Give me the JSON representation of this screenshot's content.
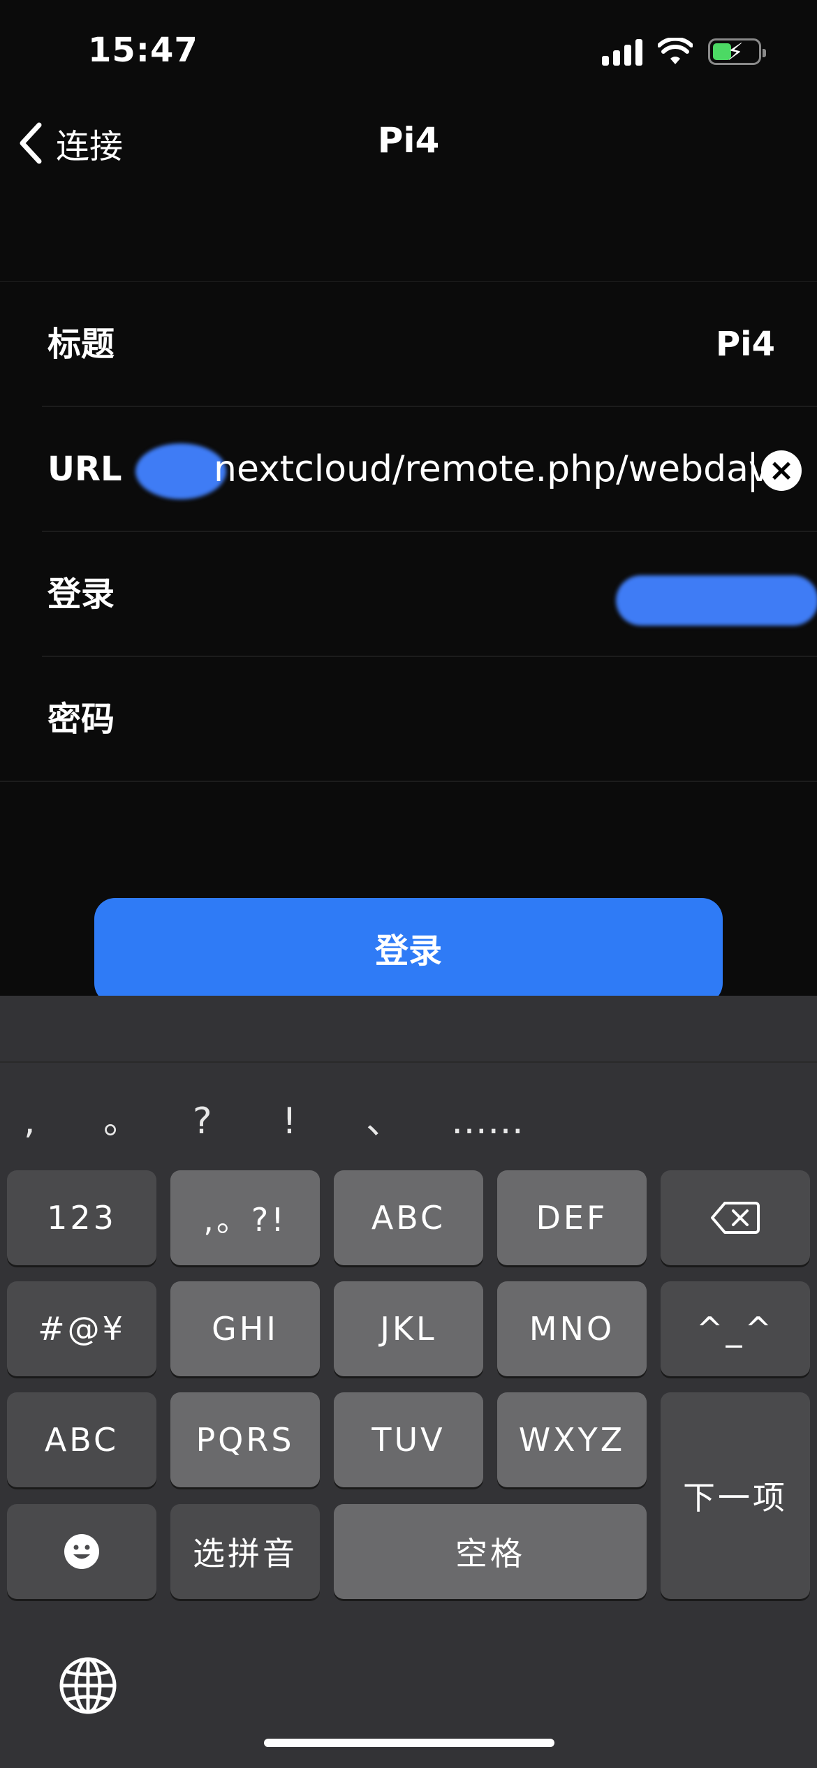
{
  "status_bar": {
    "time": "15:47"
  },
  "nav": {
    "back_label": "连接",
    "title": "Pi4"
  },
  "form": {
    "title_label": "标题",
    "title_value": "Pi4",
    "url_label": "URL",
    "url_value": "nextcloud/remote.php/webdav",
    "login_label": "登录",
    "password_label": "密码"
  },
  "login_button": {
    "label": "登录"
  },
  "keyboard": {
    "punctuation": [
      ",",
      "。",
      "?",
      "!",
      "、",
      "……"
    ],
    "keys": {
      "k123": "123",
      "punct": ",。?!",
      "abc": "ABC",
      "def": "DEF",
      "symbols": "#@¥",
      "ghi": "GHI",
      "jkl": "JKL",
      "mno": "MNO",
      "kaomoji": "^_^",
      "abc_switch": "ABC",
      "pqrs": "PQRS",
      "tuv": "TUV",
      "wxyz": "WXYZ",
      "next": "下一项",
      "select_pinyin": "选拼音",
      "space": "空格"
    }
  },
  "colors": {
    "accent": "#2f7bf6",
    "battery": "#4cd964",
    "background": "#0b0b0b",
    "keyboard": "#333336"
  }
}
